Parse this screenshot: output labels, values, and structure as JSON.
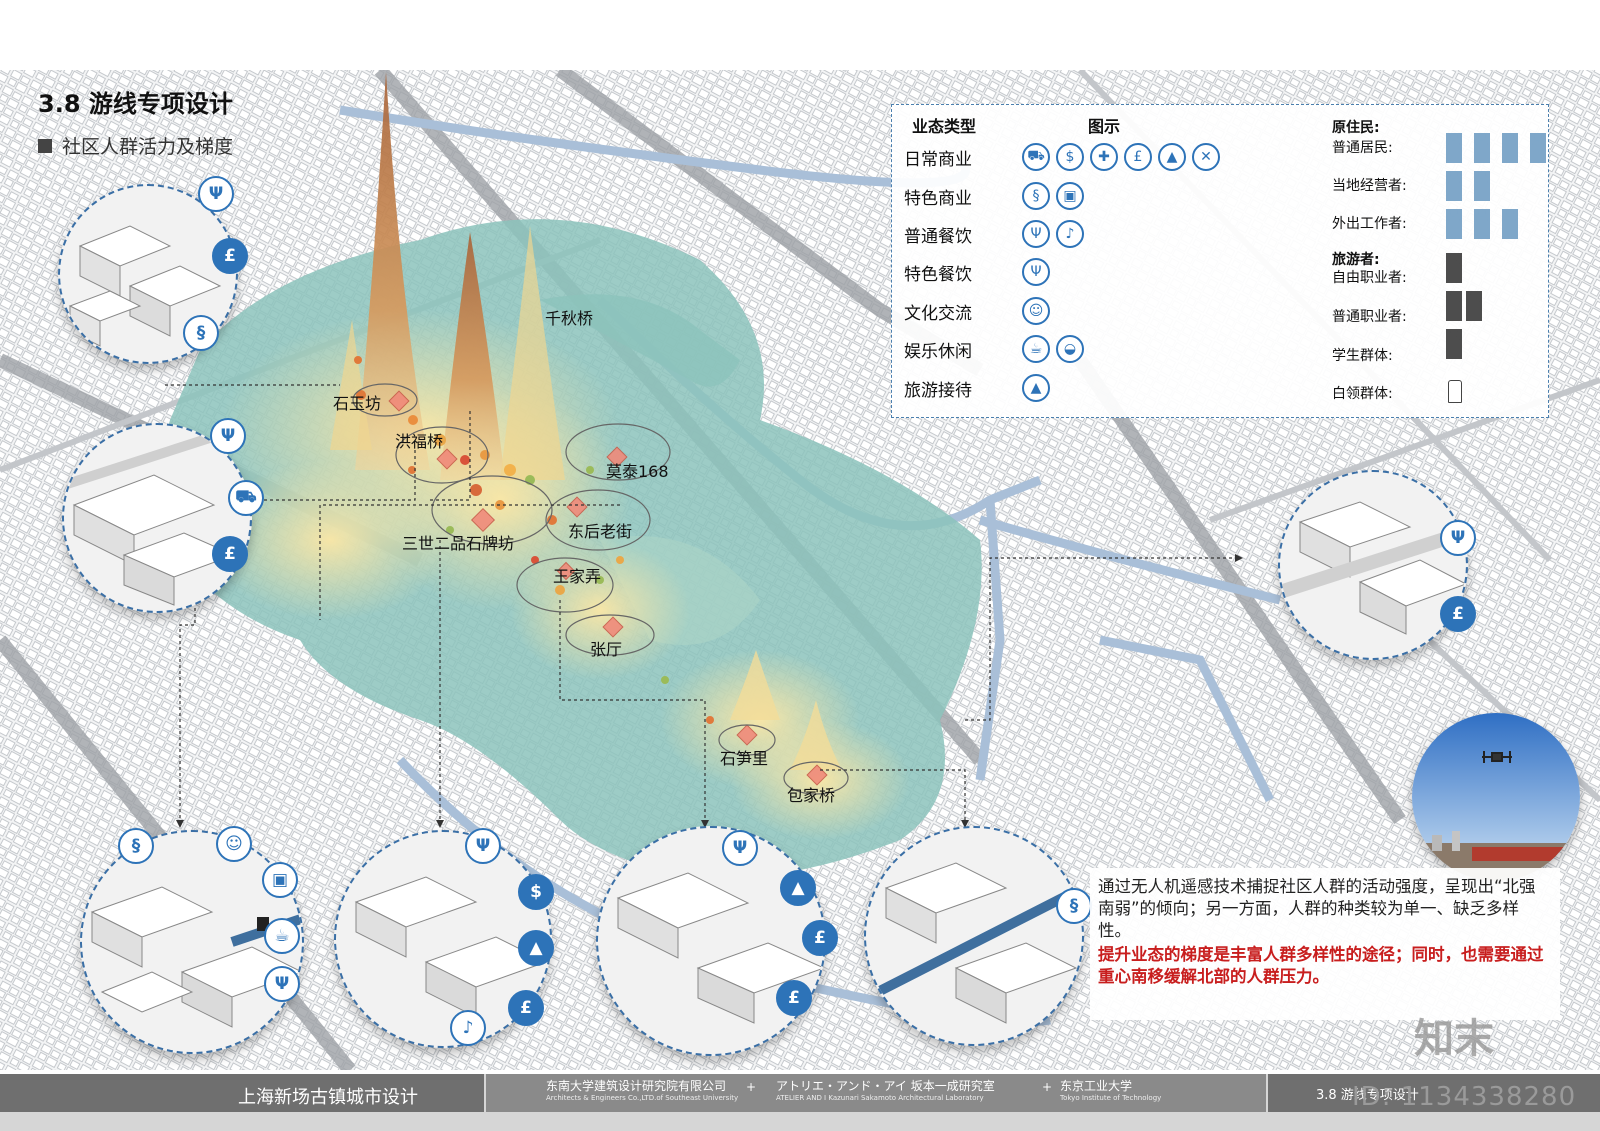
{
  "header": {
    "title": "3.8 游线专项设计",
    "subtitle": "社区人群活力及梯度"
  },
  "legend": {
    "col_type": "业态类型",
    "col_icon": "图示",
    "rows": [
      {
        "label": "日常商业",
        "icons": [
          "shopping-cart-icon",
          "money-bag-icon",
          "cross-icon",
          "pound-bag-icon",
          "dress-icon",
          "tools-icon"
        ]
      },
      {
        "label": "特色商业",
        "icons": [
          "swan-icon",
          "gift-icon"
        ]
      },
      {
        "label": "普通餐饮",
        "icons": [
          "fork-knife-icon",
          "chicken-icon"
        ]
      },
      {
        "label": "特色餐饮",
        "icons": [
          "fork-knife-icon"
        ]
      },
      {
        "label": "文化交流",
        "icons": [
          "person-icon"
        ]
      },
      {
        "label": "娱乐休闲",
        "icons": [
          "teacup-icon",
          "cake-icon"
        ]
      },
      {
        "label": "旅游接待",
        "icons": [
          "tent-icon"
        ]
      }
    ],
    "people": [
      {
        "label": "原住民:",
        "heading": true
      },
      {
        "label": "普通居民:",
        "count": 4,
        "color": "#7fa7c9"
      },
      {
        "label": "当地经营者:",
        "count": 2,
        "color": "#7fa7c9"
      },
      {
        "label": "外出工作者:",
        "count": 3,
        "color": "#7fa7c9"
      },
      {
        "label": "旅游者:",
        "heading": true
      },
      {
        "label": "自由职业者:",
        "count": 1,
        "color": "#4d4d4d"
      },
      {
        "label": "普通职业者:",
        "count": 2,
        "color": "#4d4d4d"
      },
      {
        "label": "学生群体:",
        "count": 1,
        "color": "#4d4d4d"
      },
      {
        "label": "白领群体:",
        "count": 1,
        "color": "#ffffff"
      }
    ]
  },
  "places": [
    "千秋桥",
    "石玉坊",
    "洪福桥",
    "莫泰168",
    "东后老街",
    "三世二品石牌坊",
    "王家弄",
    "张厅",
    "石笋里",
    "包家桥"
  ],
  "note": {
    "text": "通过无人机遥感技术捕捉社区人群的活动强度，呈现出“北强南弱”的倾向；另一方面，人群的种类较为单一、缺乏多样性。",
    "highlight": "提升业态的梯度是丰富人群多样性的途径；同时，也需要通过重心南移缓解北部的人群压力。"
  },
  "footer": {
    "project": "上海新场古镇城市设计",
    "org1": "东南大学建筑设计研究院有限公司",
    "org1_en": "Architects & Engineers Co.,LTD.of Southeast University",
    "org2": "アトリエ・アンド・アイ  坂本一成研究室",
    "org2_en": "ATELIER AND I Kazunari Sakamoto Architectural Laboratory",
    "org3": "东京工业大学",
    "org3_en": "Tokyo Institute of Technology",
    "section": "3.8 游线专项设计"
  },
  "watermark": {
    "logo": "知末",
    "id": "ID: 1134338280"
  },
  "colors": {
    "accent": "#2d73b8",
    "heat": "#8fc4bd",
    "peak": "#b8774a",
    "highlight_text": "#c81e1e"
  }
}
